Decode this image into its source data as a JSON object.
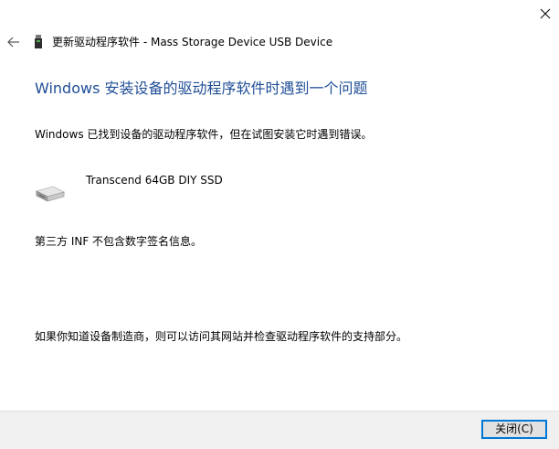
{
  "window": {
    "close_icon": "close-icon"
  },
  "header": {
    "back_icon": "back-arrow-icon",
    "device_icon": "usb-device-icon",
    "title": "更新驱动程序软件 - Mass Storage Device USB Device"
  },
  "main": {
    "heading": "Windows 安装设备的驱动程序软件时遇到一个问题",
    "found_message": "Windows 已找到设备的驱动程序软件，但在试图安装它时遇到错误。",
    "device": {
      "icon": "drive-icon",
      "name": "Transcend 64GB DIY SSD"
    },
    "inf_message": "第三方 INF 不包含数字签名信息。",
    "support_message": "如果你知道设备制造商，则可以访问其网站并检查驱动程序软件的支持部分。"
  },
  "footer": {
    "close_button_label": "关闭(C)"
  },
  "colors": {
    "heading": "#1f4e96",
    "footer_bg": "#f0f0f0",
    "button_border": "#0078d7"
  }
}
